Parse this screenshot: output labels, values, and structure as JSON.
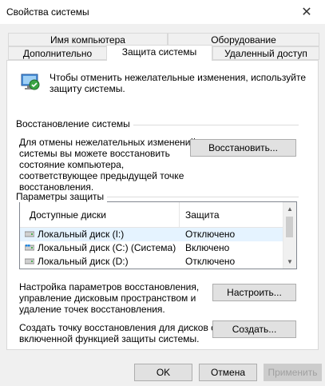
{
  "window": {
    "title": "Свойства системы",
    "close_glyph": "✕"
  },
  "tabs": {
    "row_top": [
      {
        "label": "Имя компьютера"
      },
      {
        "label": "Оборудование"
      }
    ],
    "row_bottom": [
      {
        "label": "Дополнительно"
      },
      {
        "label": "Защита системы",
        "active": true
      },
      {
        "label": "Удаленный доступ"
      }
    ]
  },
  "intro": {
    "text_line1": "Чтобы отменить нежелательные изменения, используйте",
    "text_line2": "защиту системы."
  },
  "restore": {
    "group_title": "Восстановление системы",
    "desc_line1": "Для отмены нежелательных изменений",
    "desc_line2": "системы вы можете восстановить",
    "desc_line3": "состояние компьютера,",
    "desc_line4": "соответствующее предыдущей точке",
    "desc_line5": "восстановления.",
    "button_label": "Восстановить..."
  },
  "protection": {
    "group_title": "Параметры защиты",
    "columns": [
      "Доступные диски",
      "Защита"
    ],
    "rows": [
      {
        "disk": "Локальный диск (I:)",
        "status": "Отключено",
        "icon": "drive-icon"
      },
      {
        "disk": "Локальный диск (C:) (Система)",
        "status": "Включено",
        "icon": "system-drive-icon"
      },
      {
        "disk": "Локальный диск (D:)",
        "status": "Отключено",
        "icon": "drive-icon"
      }
    ],
    "configure_line1": "Настройка параметров восстановления,",
    "configure_line2": "управление дисковым пространством и",
    "configure_line3": "удаление точек восстановления.",
    "configure_button": "Настроить...",
    "create_line1": "Создать точку восстановления для дисков с",
    "create_line2": "включенной функцией защиты системы.",
    "create_button": "Создать..."
  },
  "footer": {
    "ok_label": "OK",
    "cancel_label": "Отмена",
    "apply_label": "Применить"
  }
}
